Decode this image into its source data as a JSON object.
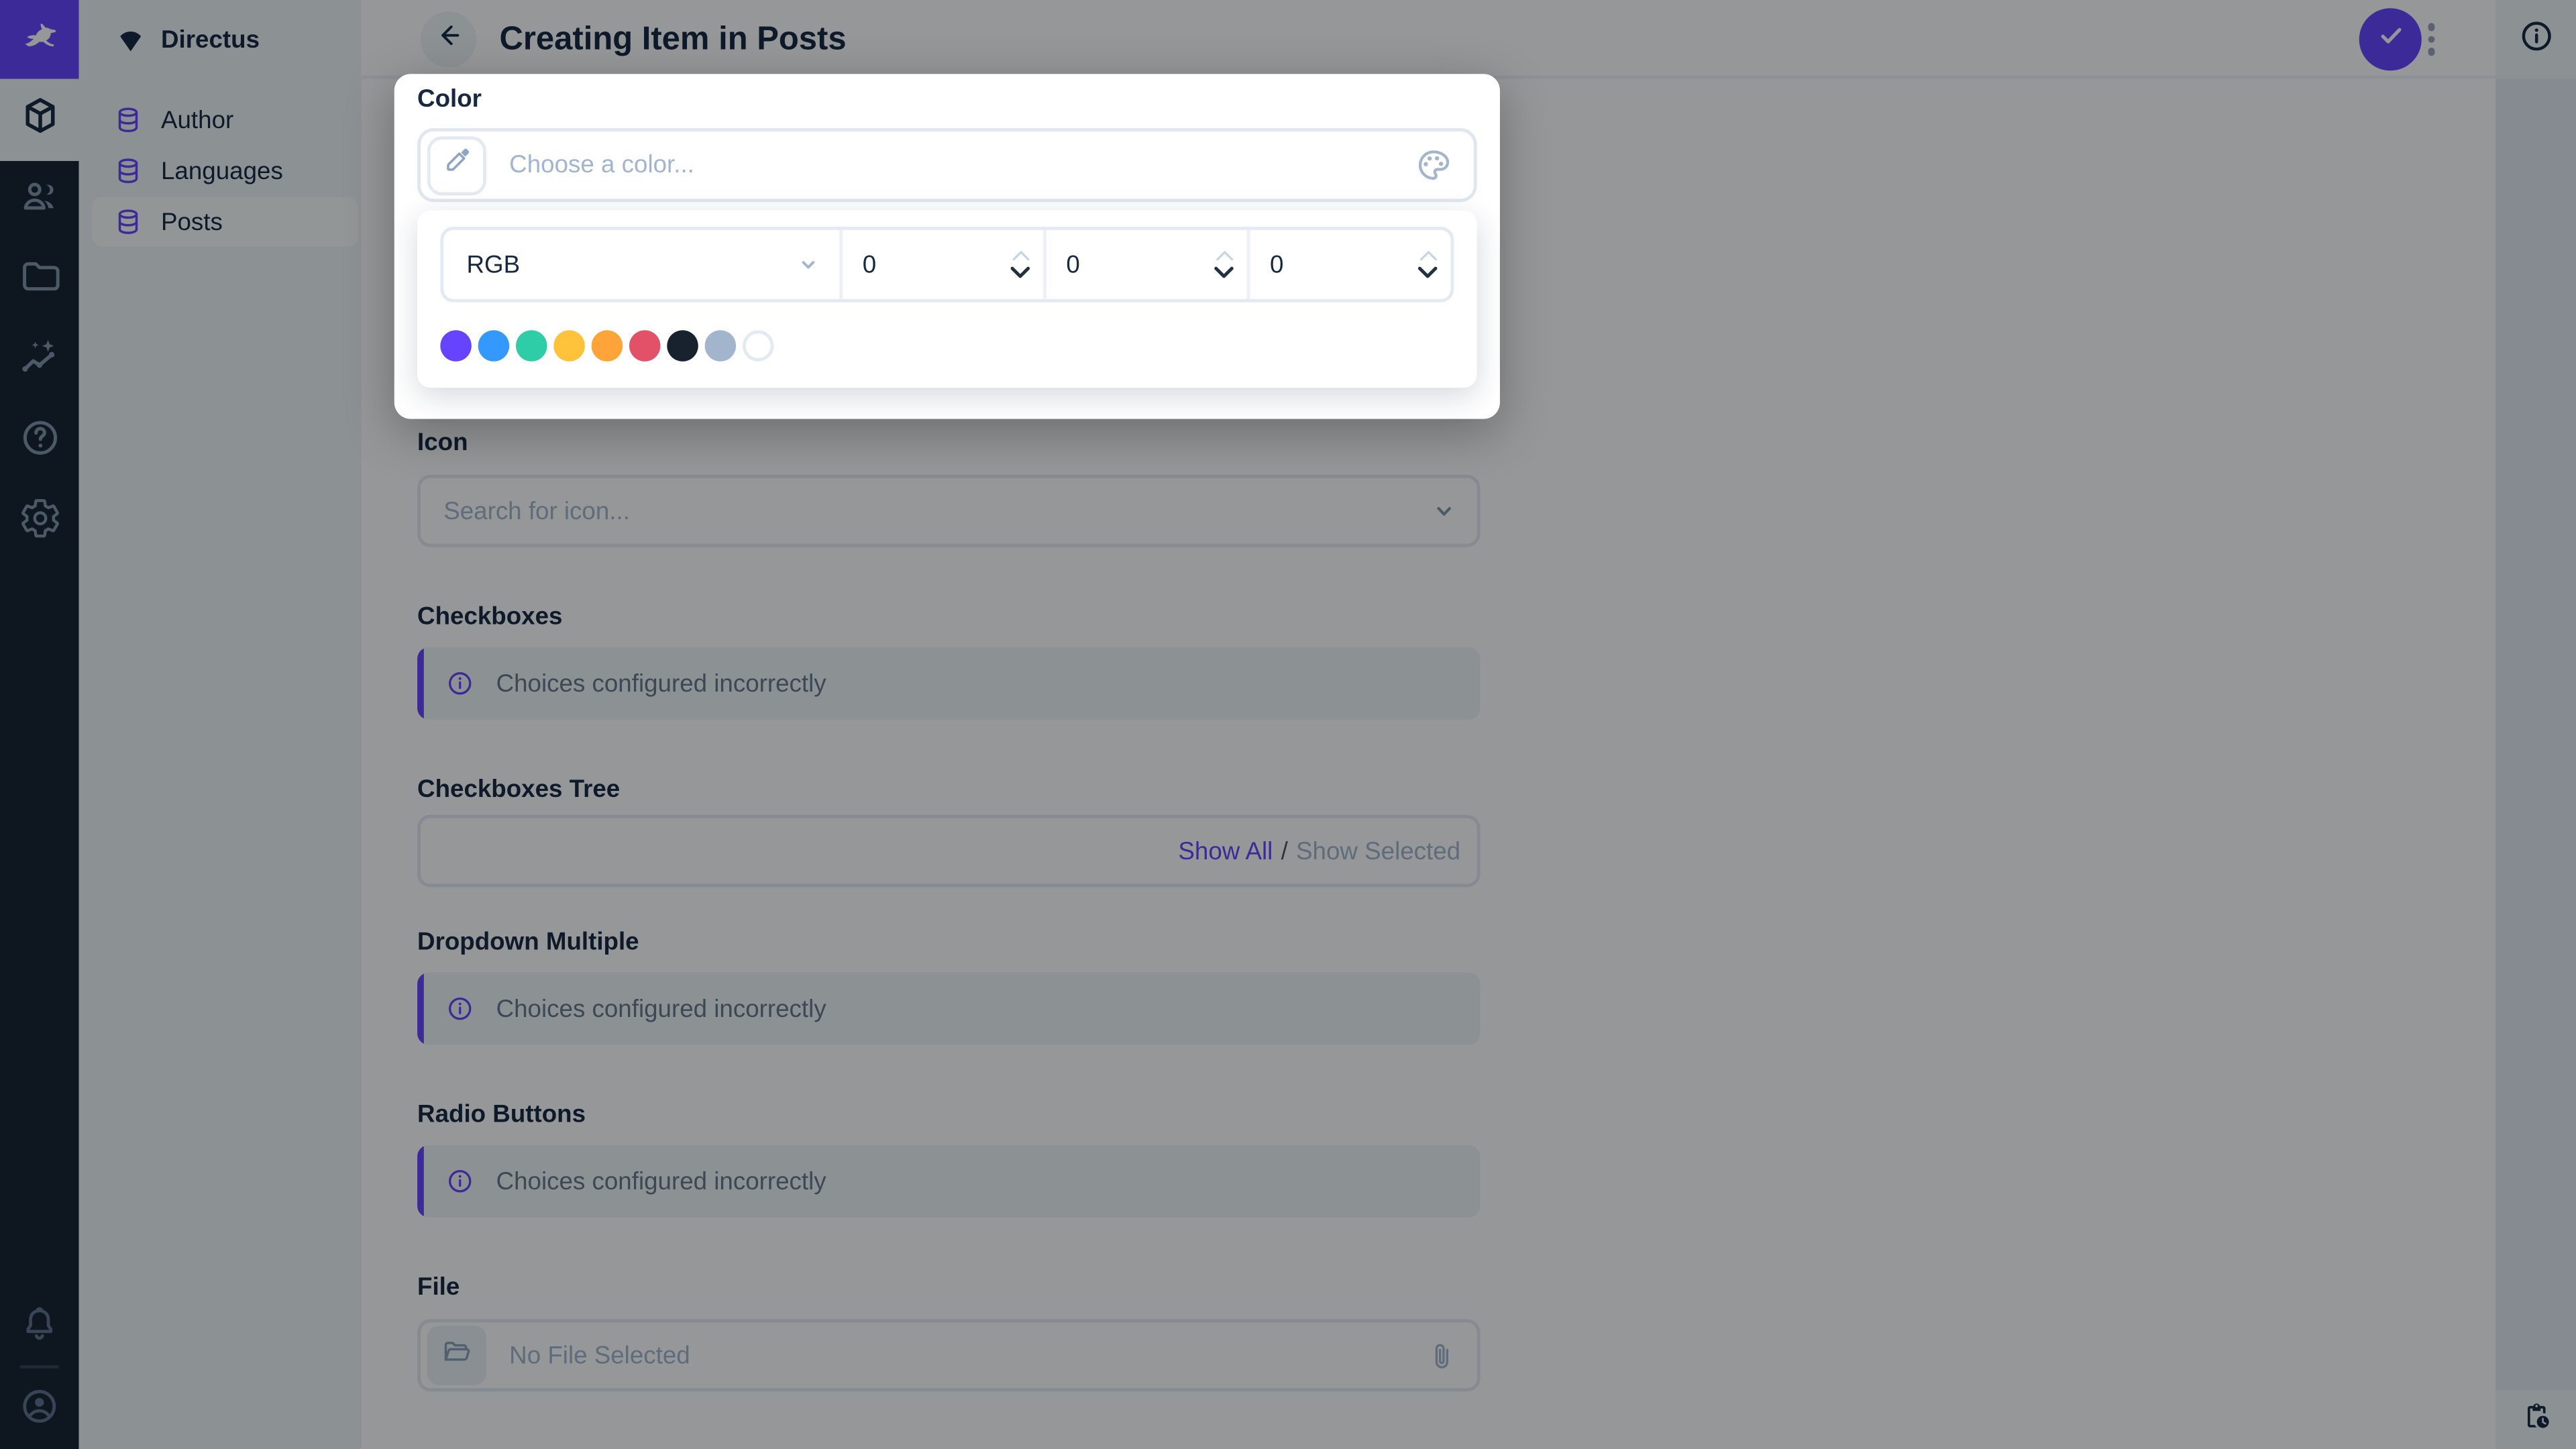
{
  "colors": {
    "primary": "#6644FF",
    "module_bar_bg": "#18222F",
    "sidebar_bg": "#F0F4F9",
    "border": "#E4EAF1",
    "text_dark": "#172940",
    "text_muted": "#68788C",
    "placeholder": "#A2B5CD"
  },
  "module_bar": {
    "modules": [
      {
        "name": "content",
        "icon": "cube-icon",
        "active": true
      },
      {
        "name": "users",
        "icon": "users-icon",
        "active": false
      },
      {
        "name": "files",
        "icon": "folder-icon",
        "active": false
      },
      {
        "name": "insights",
        "icon": "insights-icon",
        "active": false
      },
      {
        "name": "docs",
        "icon": "help-icon",
        "active": false
      },
      {
        "name": "settings",
        "icon": "gear-icon",
        "active": false
      }
    ],
    "bottom_icons": [
      "bell-icon",
      "account-circle-icon"
    ]
  },
  "nav": {
    "project_name": "Directus",
    "items": [
      {
        "label": "Author",
        "active": false
      },
      {
        "label": "Languages",
        "active": false
      },
      {
        "label": "Posts",
        "active": true
      }
    ]
  },
  "header": {
    "title": "Creating Item in Posts"
  },
  "right_sidebar": {
    "top_icon": "info-icon",
    "bottom_icon": "revisions-clipboard-clock-icon"
  },
  "color_popup": {
    "field_label": "Color",
    "input_placeholder": "Choose a color...",
    "mode": "RGB",
    "channel_values": [
      "0",
      "0",
      "0"
    ],
    "swatches": [
      "#6644FF",
      "#3399FF",
      "#2ECDA7",
      "#FFC23B",
      "#FFA439",
      "#E35169",
      "#18222F",
      "#A2B5CD",
      "#FFFFFF"
    ]
  },
  "fields": {
    "icon": {
      "label": "Icon",
      "placeholder": "Search for icon..."
    },
    "checkboxes": {
      "label": "Checkboxes",
      "notice": "Choices configured incorrectly"
    },
    "checkboxes_tree": {
      "label": "Checkboxes Tree",
      "show_all": "Show All",
      "separator": "/",
      "show_selected": "Show Selected"
    },
    "dropdown_multiple": {
      "label": "Dropdown Multiple",
      "notice": "Choices configured incorrectly"
    },
    "radio_buttons": {
      "label": "Radio Buttons",
      "notice": "Choices configured incorrectly"
    },
    "file": {
      "label": "File",
      "placeholder": "No File Selected"
    }
  }
}
